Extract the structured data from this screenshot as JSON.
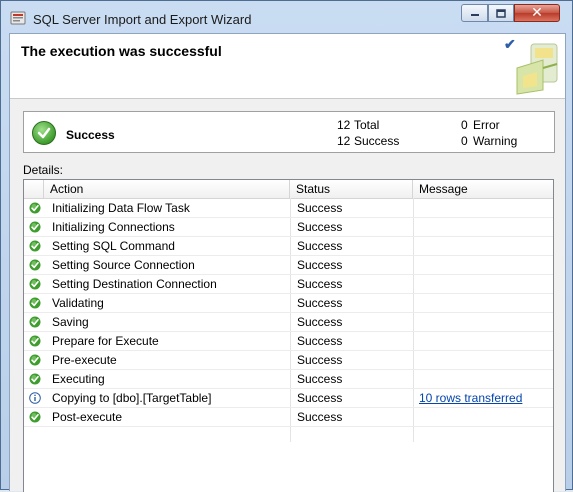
{
  "window": {
    "title": "SQL Server Import and Export Wizard",
    "close_glyph": "✕"
  },
  "header": {
    "title": "The execution was successful"
  },
  "summary": {
    "status": "Success",
    "total_count": "12",
    "total_label": "Total",
    "success_count": "12",
    "success_label": "Success",
    "error_count": "0",
    "error_label": "Error",
    "warning_count": "0",
    "warning_label": "Warning"
  },
  "details": {
    "label": "Details:",
    "columns": [
      "Action",
      "Status",
      "Message"
    ],
    "rows": [
      {
        "icon": "success-icon",
        "action": "Initializing Data Flow Task",
        "status": "Success",
        "message": ""
      },
      {
        "icon": "success-icon",
        "action": "Initializing Connections",
        "status": "Success",
        "message": ""
      },
      {
        "icon": "success-icon",
        "action": "Setting SQL Command",
        "status": "Success",
        "message": ""
      },
      {
        "icon": "success-icon",
        "action": "Setting Source Connection",
        "status": "Success",
        "message": ""
      },
      {
        "icon": "success-icon",
        "action": "Setting Destination Connection",
        "status": "Success",
        "message": ""
      },
      {
        "icon": "success-icon",
        "action": "Validating",
        "status": "Success",
        "message": ""
      },
      {
        "icon": "success-icon",
        "action": "Saving",
        "status": "Success",
        "message": ""
      },
      {
        "icon": "success-icon",
        "action": "Prepare for Execute",
        "status": "Success",
        "message": ""
      },
      {
        "icon": "success-icon",
        "action": "Pre-execute",
        "status": "Success",
        "message": ""
      },
      {
        "icon": "success-icon",
        "action": "Executing",
        "status": "Success",
        "message": ""
      },
      {
        "icon": "info-icon",
        "action": "Copying to [dbo].[TargetTable]",
        "status": "Success",
        "message": "10 rows transferred"
      },
      {
        "icon": "success-icon",
        "action": "Post-execute",
        "status": "Success",
        "message": ""
      }
    ]
  },
  "colors": {
    "success_green": "#3f9d2e",
    "info_blue": "#2f5fa3",
    "link": "#0645ad"
  }
}
